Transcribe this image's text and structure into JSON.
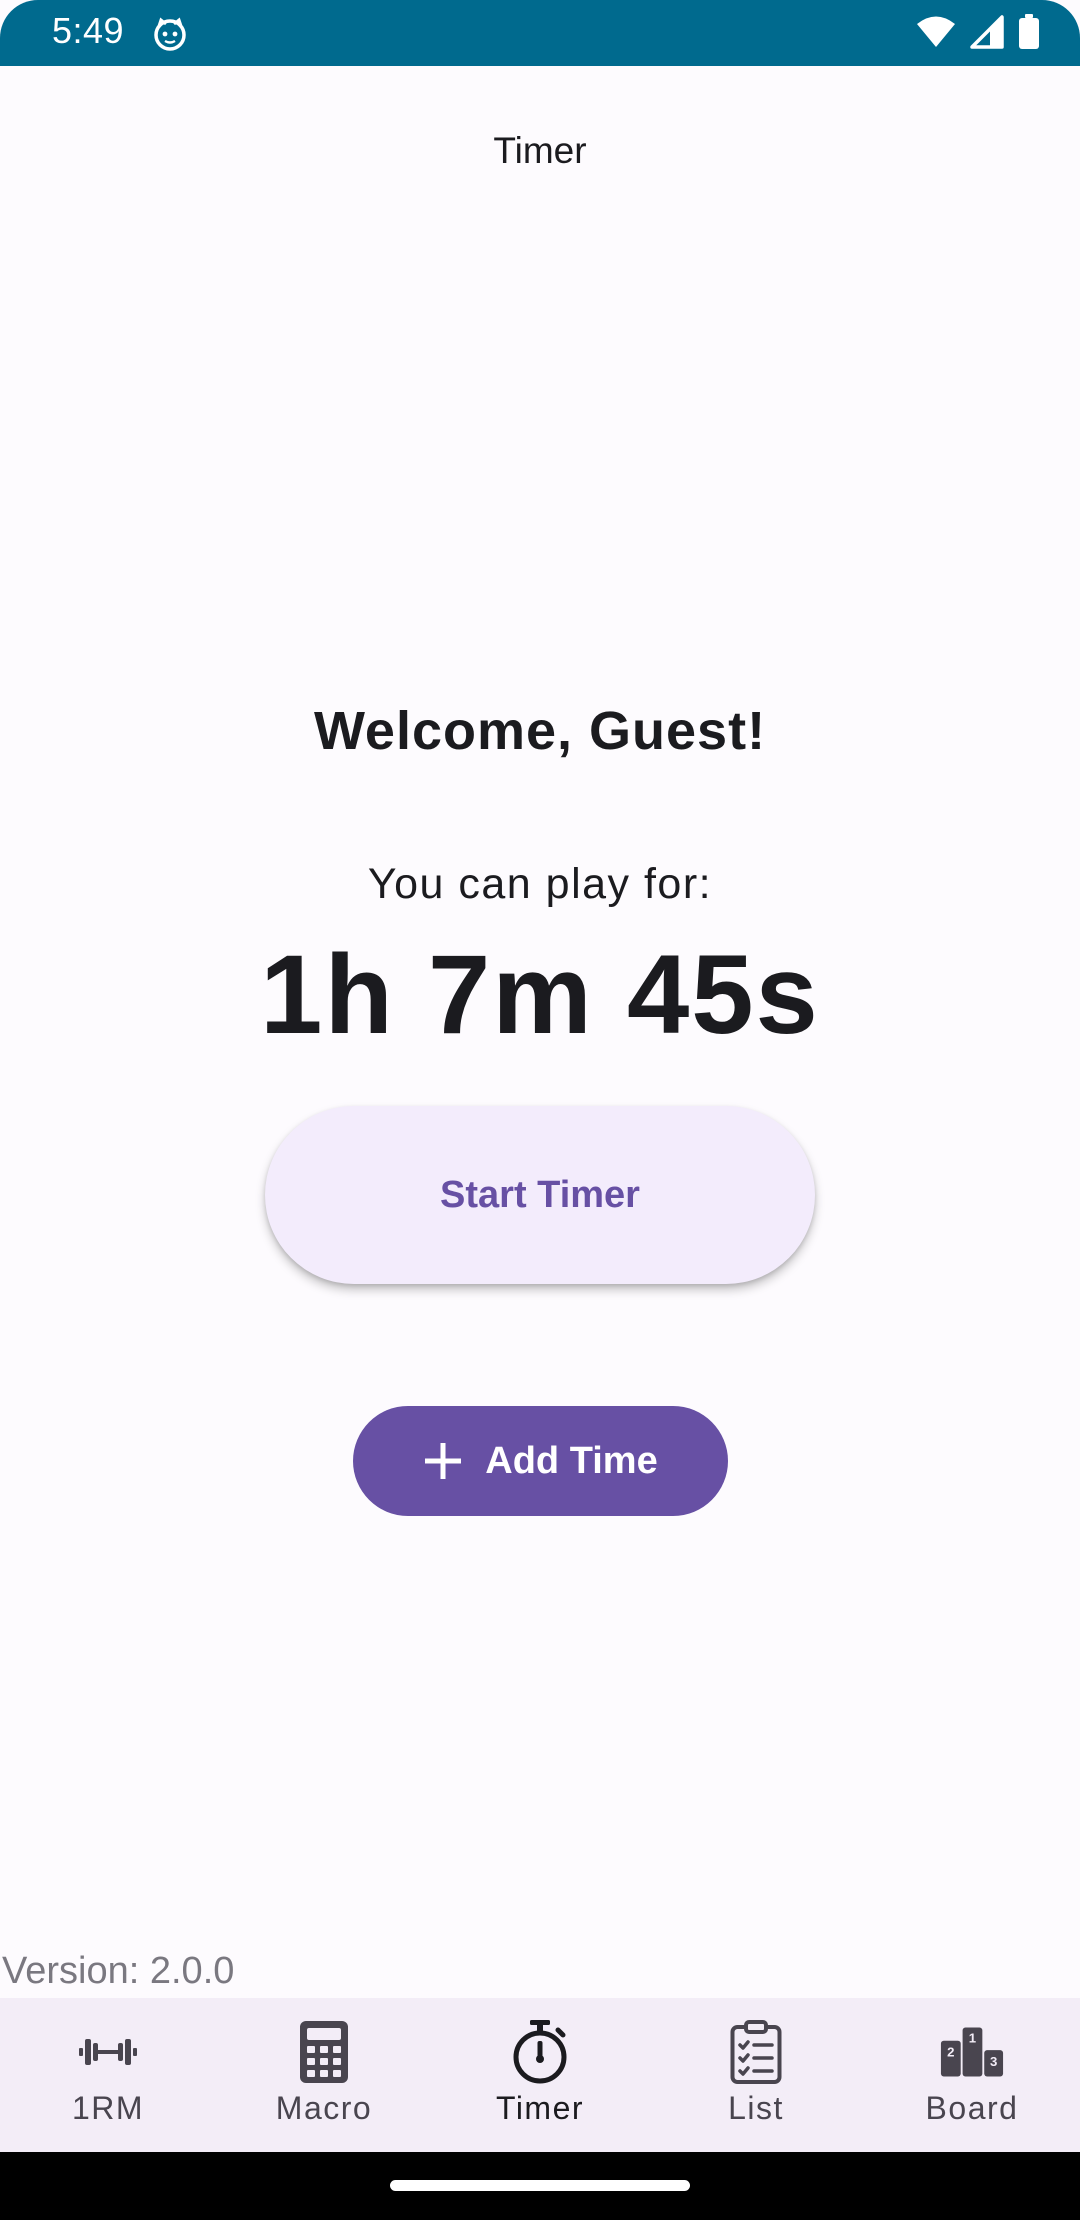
{
  "status_bar": {
    "time": "5:49",
    "icons": [
      "app-notification-icon",
      "wifi-icon",
      "cell-signal-icon",
      "battery-icon"
    ],
    "background": "#006a8e"
  },
  "header": {
    "title": "Timer"
  },
  "main": {
    "welcome": "Welcome, Guest!",
    "play_label": "You can play for:",
    "countdown": "1h 7m 45s",
    "start_button": "Start Timer",
    "add_button": "Add Time"
  },
  "footer": {
    "version": "Version: 2.0.0"
  },
  "bottom_nav": {
    "items": [
      {
        "label": "1RM",
        "icon": "dumbbell-icon"
      },
      {
        "label": "Macro",
        "icon": "calculator-icon"
      },
      {
        "label": "Timer",
        "icon": "stopwatch-icon",
        "active": true
      },
      {
        "label": "List",
        "icon": "checklist-icon"
      },
      {
        "label": "Board",
        "icon": "podium-icon"
      }
    ]
  },
  "colors": {
    "accent": "#6750a4",
    "start_button_bg": "#f3ecfc",
    "nav_bg": "#f3edf7",
    "background": "#fdfbfe"
  }
}
